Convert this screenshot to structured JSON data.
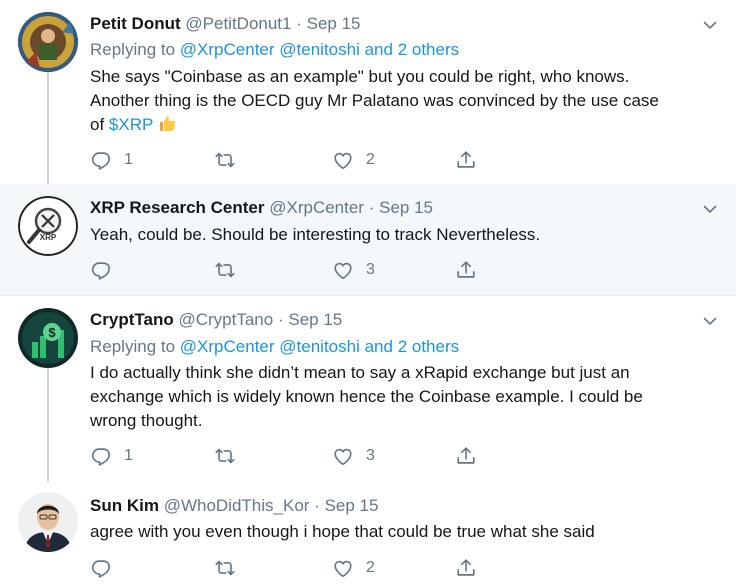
{
  "tweets": [
    {
      "name": "Petit Donut",
      "handle": "@PetitDonut1",
      "time": "Sep 15",
      "replying_prefix": "Replying to",
      "replying_users": [
        "@XrpCenter",
        "@tenitoshi"
      ],
      "replying_and": "and",
      "replying_others": "2 others",
      "text_line1": "She says \"Coinbase as an example\" but you could be right, who knows.",
      "text_line2": "Another thing is the OECD guy Mr Palatano was convinced by the use case",
      "text_line3_prefix": "of",
      "cashtag": "$XRP",
      "replies": "1",
      "likes": "2"
    },
    {
      "name": "XRP Research Center",
      "handle": "@XrpCenter",
      "time": "Sep 15",
      "text": "Yeah, could be. Should be interesting to track Nevertheless.",
      "likes": "3",
      "avatar_label": "XRP"
    },
    {
      "name": "CryptTano",
      "handle": "@CryptTano",
      "time": "Sep 15",
      "replying_prefix": "Replying to",
      "replying_users": [
        "@XrpCenter",
        "@tenitoshi"
      ],
      "replying_and": "and",
      "replying_others": "2 others",
      "text_line1": "I do actually think she didn’t mean to say a xRapid exchange but just an",
      "text_line2": "exchange which is widely known hence the Coinbase example. I could be",
      "text_line3": "wrong thought.",
      "replies": "1",
      "likes": "3"
    },
    {
      "name": "Sun Kim",
      "handle": "@WhoDidThis_Kor",
      "time": "Sep 15",
      "text": "agree with you even though i hope that could be true what she said",
      "likes": "2"
    }
  ],
  "separator": "·",
  "icons": [
    "chevron-down-icon",
    "reply-icon",
    "retweet-icon",
    "like-icon",
    "share-icon",
    "thumbs-up-emoji"
  ],
  "colors": {
    "link": "#1b95e0",
    "muted": "#657786",
    "highlight_bg": "#f5f8fa",
    "divider": "#e6ecf0",
    "thread_line": "#ccd6dd"
  }
}
